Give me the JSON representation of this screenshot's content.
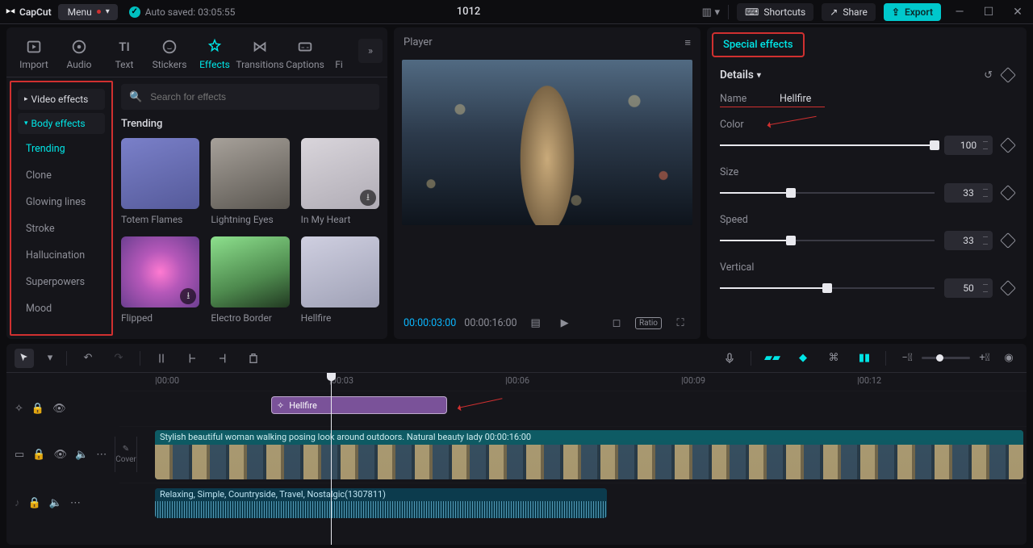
{
  "app": {
    "name": "CapCut",
    "menu": "Menu",
    "autosaved": "Auto saved: 03:05:55",
    "project": "1012"
  },
  "titlebar": {
    "shortcuts": "Shortcuts",
    "share": "Share",
    "export": "Export"
  },
  "topTabs": {
    "import": "Import",
    "audio": "Audio",
    "text": "Text",
    "stickers": "Stickers",
    "effects": "Effects",
    "transitions": "Transitions",
    "captions": "Captions",
    "filters": "Fi"
  },
  "sidebar": {
    "video": "Video effects",
    "body": "Body effects",
    "items": {
      "trending": "Trending",
      "clone": "Clone",
      "glowing": "Glowing lines",
      "stroke": "Stroke",
      "halluc": "Hallucination",
      "superpowers": "Superpowers",
      "mood": "Mood"
    }
  },
  "browse": {
    "searchPlaceholder": "Search for effects",
    "sectionTitle": "Trending",
    "cards": {
      "totem": "Totem Flames",
      "lightning": "Lightning Eyes",
      "heart": "In My Heart",
      "flipped": "Flipped",
      "electro": "Electro Border",
      "hellfire": "Hellfire"
    }
  },
  "player": {
    "title": "Player",
    "pos": "00:00:03:00",
    "dur": "00:00:16:00",
    "ratio": "Ratio"
  },
  "inspector": {
    "tab": "Special effects",
    "details": "Details",
    "nameLabel": "Name",
    "nameValue": "Hellfire",
    "params": {
      "color": {
        "label": "Color",
        "value": "100",
        "pct": 100
      },
      "size": {
        "label": "Size",
        "value": "33",
        "pct": 33
      },
      "speed": {
        "label": "Speed",
        "value": "33",
        "pct": 33
      },
      "vertical": {
        "label": "Vertical",
        "value": "50",
        "pct": 50
      }
    }
  },
  "timeline": {
    "ticks": {
      "t0": "|00:00",
      "t3": "|00:03",
      "t6": "|00:06",
      "t9": "|00:09",
      "t12": "|00:12"
    },
    "cover": "Cover",
    "fxClip": "Hellfire",
    "videoTitle": "Stylish beautiful woman walking posing look around outdoors. Natural beauty lady   00:00:16:00",
    "audioTitle": "Relaxing, Simple, Countryside, Travel, Nostalgic(1307811)"
  }
}
